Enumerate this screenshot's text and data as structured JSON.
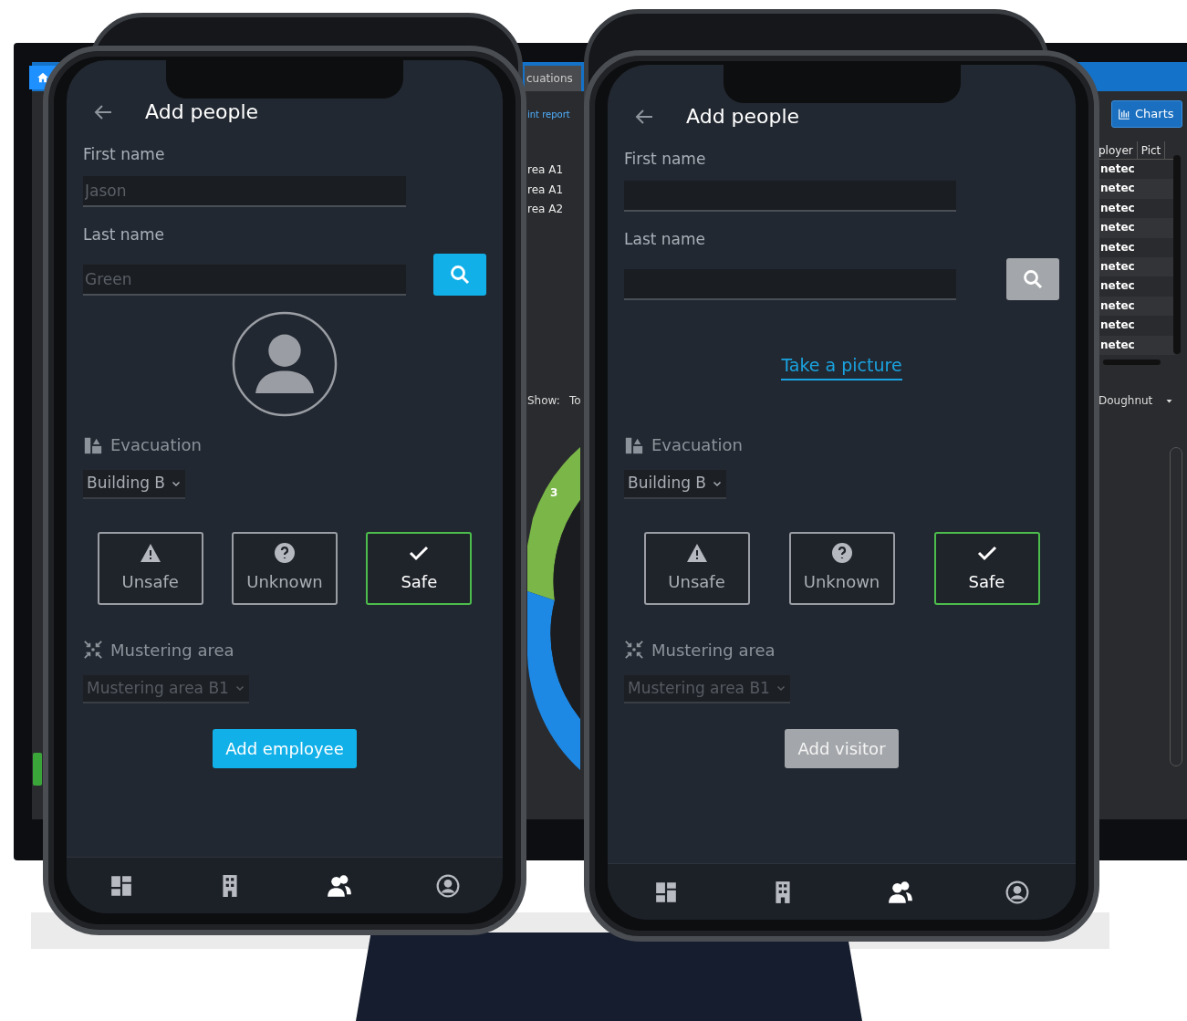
{
  "monitor": {
    "tab": "cuations",
    "link": "int report",
    "area_rows": [
      "rea A1",
      "rea A1",
      "rea A2"
    ],
    "show_label": "Show:",
    "show_value": "To",
    "donut_label": "3",
    "charts_button": "Charts",
    "table": {
      "columns": [
        "ployer",
        "Pict"
      ],
      "rows": [
        "netec",
        "netec",
        "netec",
        "netec",
        "netec",
        "netec",
        "netec",
        "netec",
        "netec",
        "netec"
      ]
    },
    "chart_type": "Doughnut"
  },
  "phones": [
    {
      "title": "Add people",
      "first_name": {
        "label": "First name",
        "placeholder": "Jason"
      },
      "last_name": {
        "label": "Last name",
        "placeholder": "Green"
      },
      "search_enabled": true,
      "photo": {
        "kind": "avatar"
      },
      "evacuation_label": "Evacuation",
      "building": "Building B",
      "statuses": [
        {
          "label": "Unsafe",
          "kind": "warning",
          "selected": false
        },
        {
          "label": "Unknown",
          "kind": "question",
          "selected": false
        },
        {
          "label": "Safe",
          "kind": "check",
          "selected": true
        }
      ],
      "mustering_label": "Mustering area",
      "mustering_area": {
        "value": "Mustering area B1",
        "disabled": true
      },
      "submit": {
        "label": "Add employee",
        "disabled": false
      },
      "nav": [
        {
          "kind": "dashboard",
          "selected": false
        },
        {
          "kind": "building",
          "selected": false
        },
        {
          "kind": "people",
          "selected": true
        },
        {
          "kind": "account",
          "selected": false
        }
      ]
    },
    {
      "title": "Add people",
      "first_name": {
        "label": "First name"
      },
      "last_name": {
        "label": "Last name"
      },
      "search_enabled": false,
      "photo": {
        "kind": "link",
        "text": "Take a picture"
      },
      "evacuation_label": "Evacuation",
      "building": "Building B",
      "statuses": [
        {
          "label": "Unsafe",
          "kind": "warning",
          "selected": false
        },
        {
          "label": "Unknown",
          "kind": "question",
          "selected": false
        },
        {
          "label": "Safe",
          "kind": "check",
          "selected": true
        }
      ],
      "mustering_label": "Mustering area",
      "mustering_area": {
        "value": "Mustering area B1",
        "disabled": true
      },
      "submit": {
        "label": "Add visitor",
        "disabled": true
      },
      "nav": [
        {
          "kind": "dashboard",
          "selected": false
        },
        {
          "kind": "building",
          "selected": false
        },
        {
          "kind": "people",
          "selected": true
        },
        {
          "kind": "account",
          "selected": false
        }
      ]
    }
  ]
}
